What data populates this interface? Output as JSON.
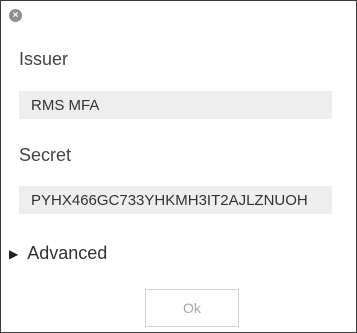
{
  "dialog": {
    "close_icon_glyph": "×",
    "issuer": {
      "label": "Issuer",
      "value": "RMS MFA"
    },
    "secret": {
      "label": "Secret",
      "value": "PYHX466GC733YHKMH3IT2AJLZNUOH"
    },
    "advanced": {
      "glyph": "▶",
      "label": "Advanced",
      "expanded": false
    },
    "ok_button": {
      "label": "Ok",
      "disabled": true
    }
  }
}
